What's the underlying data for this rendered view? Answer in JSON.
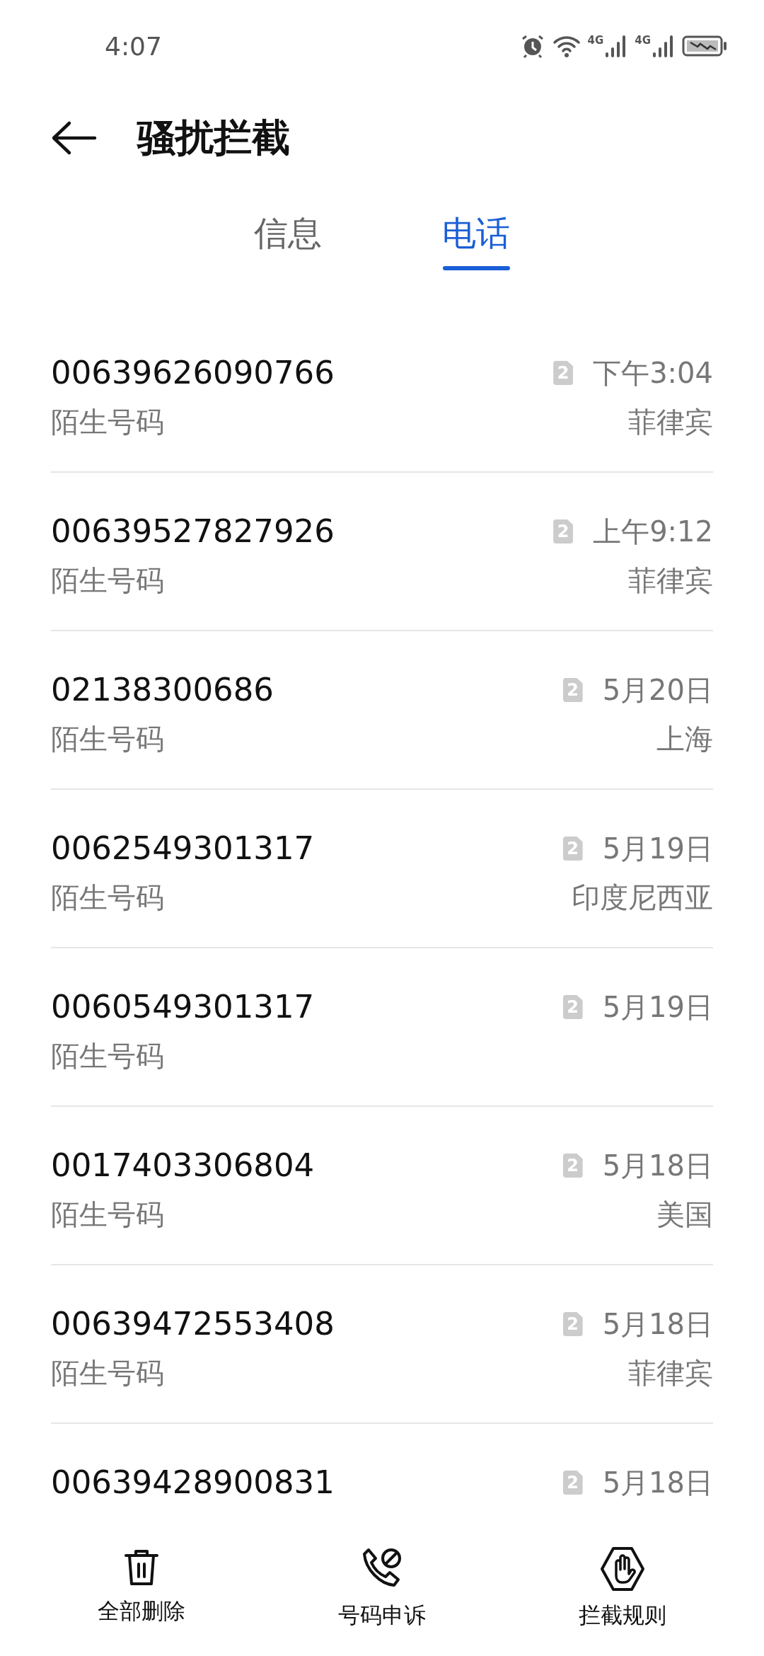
{
  "status_bar": {
    "time": "4:07",
    "networks": [
      "4G",
      "4G"
    ]
  },
  "header": {
    "title": "骚扰拦截"
  },
  "tabs": [
    {
      "label": "信息",
      "selected": false
    },
    {
      "label": "电话",
      "selected": true
    }
  ],
  "calls": [
    {
      "number": "00639626090766",
      "label": "陌生号码",
      "sim": "2",
      "time": "下午3:04",
      "location": "菲律宾"
    },
    {
      "number": "00639527827926",
      "label": "陌生号码",
      "sim": "2",
      "time": "上午9:12",
      "location": "菲律宾"
    },
    {
      "number": "02138300686",
      "label": "陌生号码",
      "sim": "2",
      "time": "5月20日",
      "location": "上海"
    },
    {
      "number": "0062549301317",
      "label": "陌生号码",
      "sim": "2",
      "time": "5月19日",
      "location": "印度尼西亚"
    },
    {
      "number": "0060549301317",
      "label": "陌生号码",
      "sim": "2",
      "time": "5月19日"
    },
    {
      "number": "0017403306804",
      "label": "陌生号码",
      "sim": "2",
      "time": "5月18日",
      "location": "美国"
    },
    {
      "number": "00639472553408",
      "label": "陌生号码",
      "sim": "2",
      "time": "5月18日",
      "location": "菲律宾"
    },
    {
      "number": "00639428900831",
      "sim": "2",
      "time": "5月18日"
    }
  ],
  "actions": [
    {
      "kind": "delete",
      "label": "全部删除"
    },
    {
      "kind": "appeal",
      "label": "号码申诉"
    },
    {
      "kind": "rules",
      "label": "拦截规则"
    }
  ]
}
